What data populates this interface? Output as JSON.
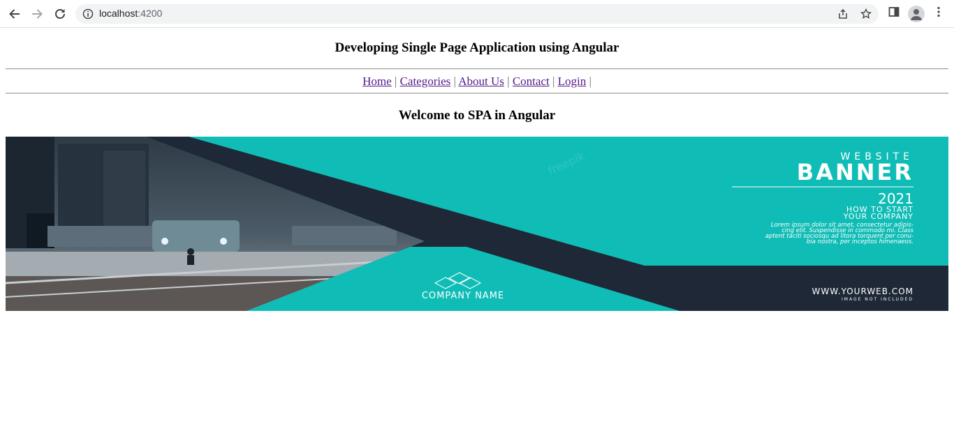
{
  "browser": {
    "url_host": "localhost",
    "url_port": ":4200"
  },
  "page": {
    "title": "Developing Single Page Application using Angular",
    "nav": [
      {
        "label": "Home"
      },
      {
        "label": "Categories"
      },
      {
        "label": "About Us"
      },
      {
        "label": "Contact"
      },
      {
        "label": "Login"
      }
    ],
    "separator": "|",
    "welcome": "Welcome to SPA in Angular"
  },
  "banner": {
    "line1": "WEBSITE",
    "line2": "BANNER",
    "year": "2021",
    "tag1": "HOW TO START",
    "tag2": "YOUR COMPANY",
    "lorem1": "Lorem ipsum dolor sit amet, consectetur adipis-",
    "lorem2": "cing elit. Suspendisse in commodo mi. Class",
    "lorem3": "aptent taciti sociosqu ad litora torquent per conu-",
    "lorem4": "bia nostra, per inceptos himenaeos.",
    "company": "COMPANY NAME",
    "website": "WWW.YOURWEB.COM",
    "small": "IMAGE NOT INCLUDED",
    "watermark": "freepik"
  },
  "colors": {
    "teal": "#10bdb6",
    "navy": "#1e2837",
    "link": "#551a8b"
  }
}
